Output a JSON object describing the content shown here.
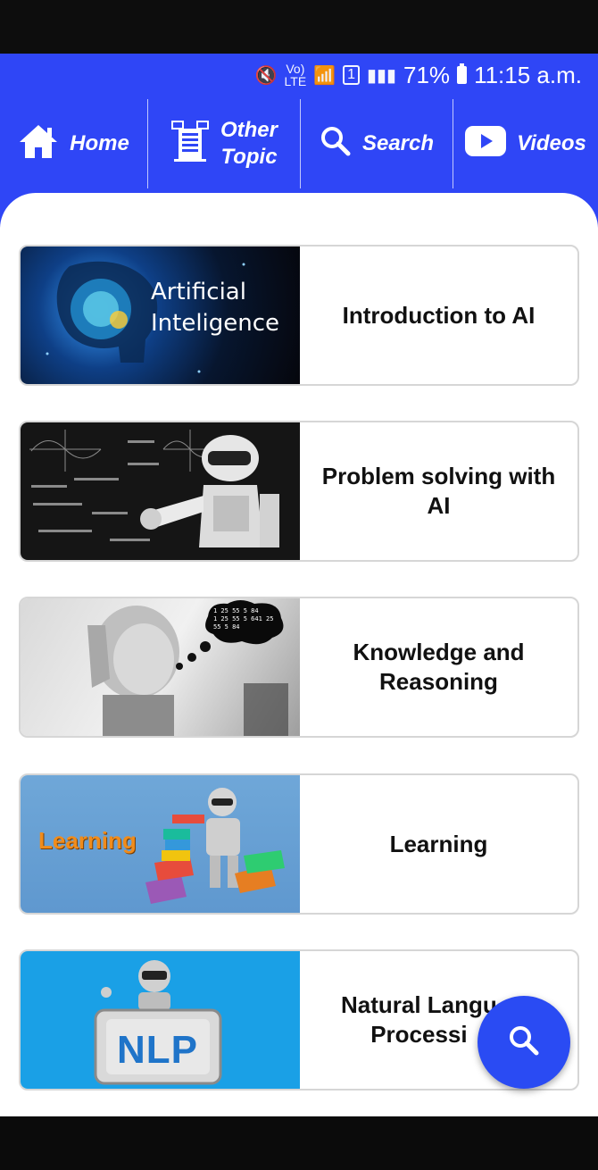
{
  "status_bar": {
    "battery_percent": "71%",
    "time": "11:15 a.m."
  },
  "nav": {
    "items": [
      {
        "label": "Home",
        "icon": "home-icon"
      },
      {
        "label": "Other\nTopic",
        "icon": "document-icon"
      },
      {
        "label": "Search",
        "icon": "search-icon"
      },
      {
        "label": "Videos",
        "icon": "video-icon"
      }
    ]
  },
  "topics": [
    {
      "title": "Introduction to AI",
      "image_text_line1": "Artificial",
      "image_text_line2": "Inteligence"
    },
    {
      "title": "Problem solving with AI"
    },
    {
      "title": "Knowledge and Reasoning",
      "bubble_lines": [
        "1 25 55 5 84",
        "1 25 55 5 641 25",
        "55 5 84"
      ]
    },
    {
      "title": "Learning",
      "image_text": "Learning"
    },
    {
      "title": "Natural Langu... Processi...",
      "title_visible": "Natural Langu\nProcessi",
      "image_text": "NLP"
    }
  ],
  "fab": {
    "icon": "search-icon"
  },
  "colors": {
    "brand": "#2f46f6",
    "fab": "#2a4bf3",
    "panel": "#ffffff"
  }
}
